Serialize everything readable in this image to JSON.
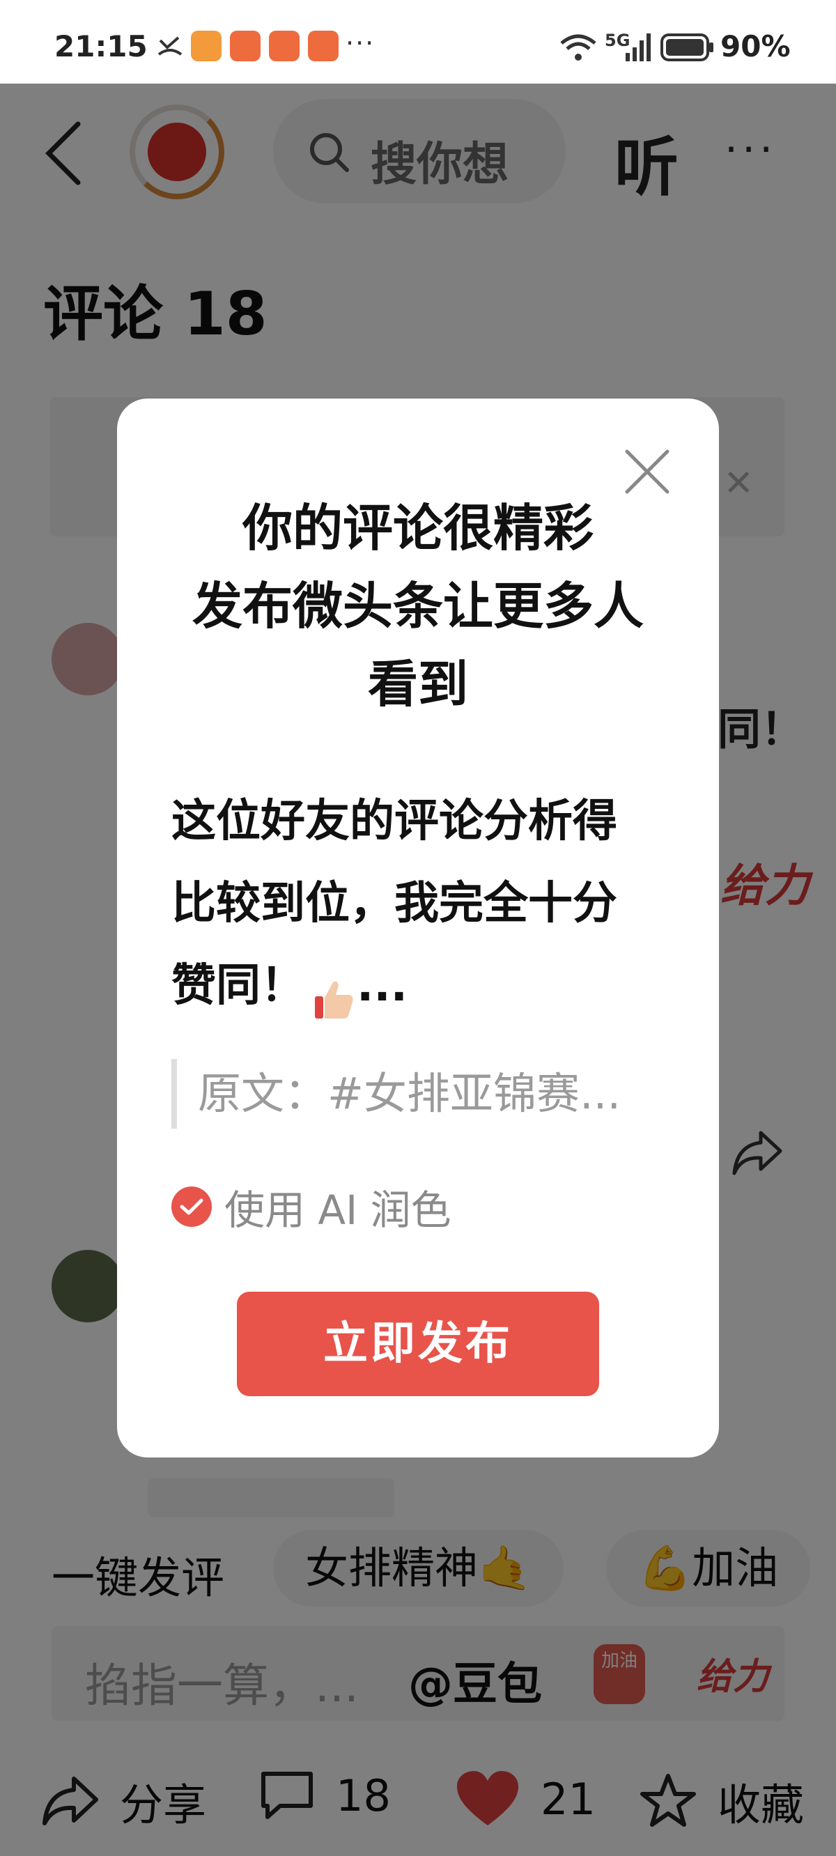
{
  "status_bar": {
    "time": "21:15",
    "battery": "90%",
    "network": "5G",
    "more": "···"
  },
  "header": {
    "search_placeholder": "搜你想",
    "listen_label": "听",
    "more": "···"
  },
  "comments": {
    "title": "评论 18",
    "peek_texts": [
      "同！",
      "给力"
    ]
  },
  "quick_comment": {
    "label": "一键发评",
    "chips": [
      "女排精神🤙",
      "💪加油"
    ]
  },
  "input_bar": {
    "placeholder": "掐指一算，...",
    "mention": "@豆包",
    "sticker_jiayou": "加油",
    "sticker_geili": "给力"
  },
  "actions": {
    "share_label": "分享",
    "comment_count": "18",
    "like_count": "21",
    "favorite_label": "收藏"
  },
  "modal": {
    "title_line1": "你的评论很精彩",
    "title_line2": "发布微头条让更多人",
    "title_line3": "看到",
    "body_line1": "这位好友的评论分析得",
    "body_line2": "比较到位，我完全十分",
    "body_line3": "赞同！",
    "body_ellipsis": "...",
    "quote": "原文：#女排亚锦赛...",
    "ai_polish_label": "使用 AI 润色",
    "ai_polish_checked": true,
    "publish_button": "立即发布"
  },
  "colors": {
    "accent": "#e8534a",
    "like": "#e0423f"
  }
}
